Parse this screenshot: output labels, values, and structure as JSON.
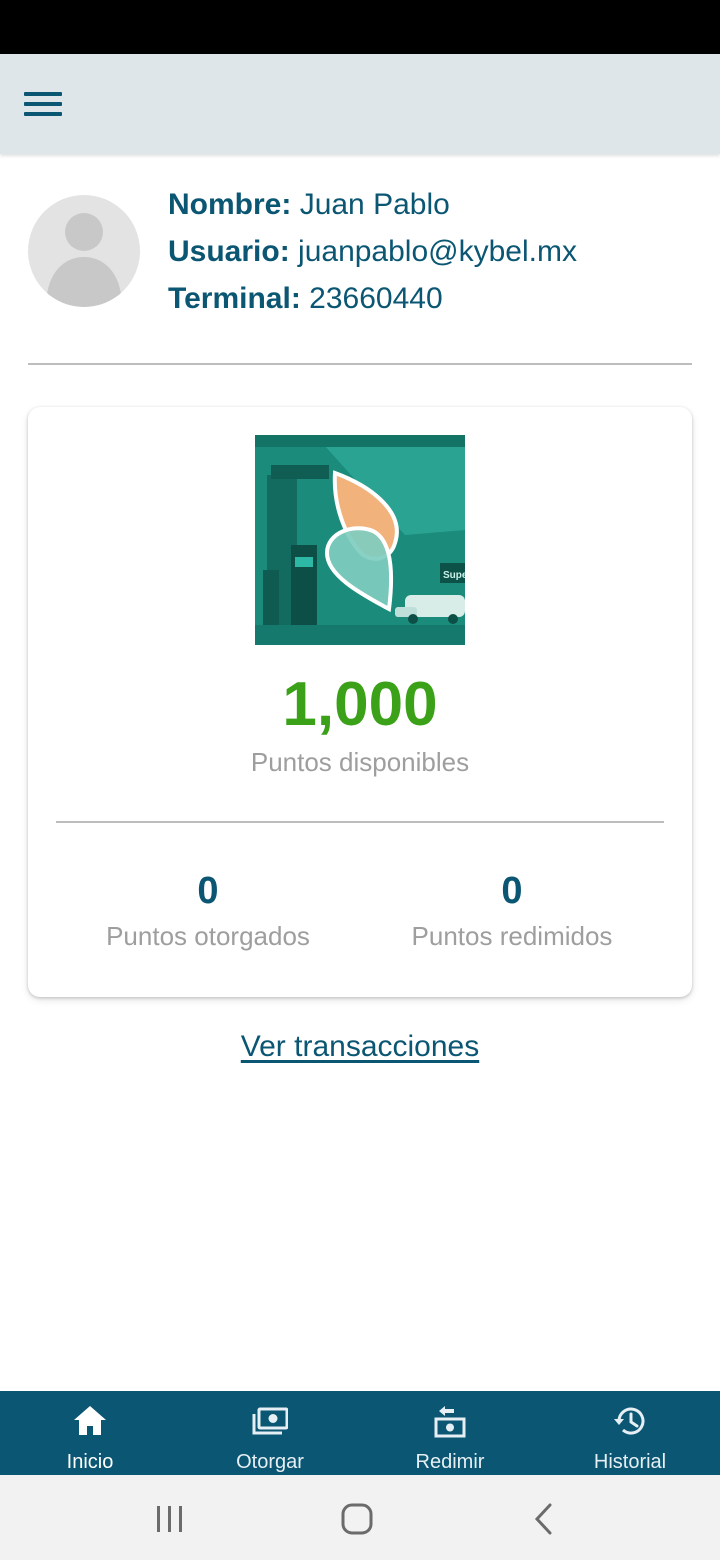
{
  "profile": {
    "name_label": "Nombre:",
    "name_value": "Juan Pablo",
    "user_label": "Usuario:",
    "user_value": "juanpablo@kybel.mx",
    "terminal_label": "Terminal:",
    "terminal_value": "23660440"
  },
  "points": {
    "available_value": "1,000",
    "available_label": "Puntos disponibles",
    "granted_value": "0",
    "granted_label": "Puntos otorgados",
    "redeemed_value": "0",
    "redeemed_label": "Puntos redimidos"
  },
  "links": {
    "transactions": "Ver transacciones"
  },
  "bottom_nav": {
    "items": [
      {
        "label": "Inicio",
        "icon": "home-icon",
        "active": true
      },
      {
        "label": "Otorgar",
        "icon": "money-icon",
        "active": false
      },
      {
        "label": "Redimir",
        "icon": "redeem-icon",
        "active": false
      },
      {
        "label": "Historial",
        "icon": "history-icon",
        "active": false
      }
    ]
  },
  "image": {
    "sign_text": "Super"
  },
  "colors": {
    "primary": "#0b5673",
    "accent_green": "#3aa118",
    "app_bar": "#dfe6e9",
    "muted_text": "#9e9e9e"
  }
}
